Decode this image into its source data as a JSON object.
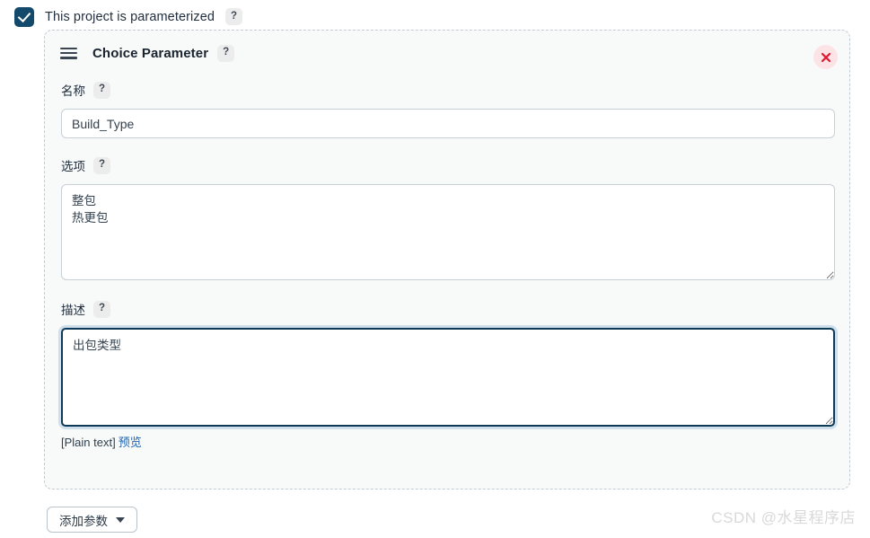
{
  "page": {
    "parameterized_toggle": {
      "label": "This project is parameterized",
      "checked": true,
      "help": "?"
    },
    "watermark": "CSDN @水星程序店"
  },
  "parameter_card": {
    "type_title": "Choice Parameter",
    "title_help": "?",
    "drag_handle_icon": "drag-handle-icon",
    "close_icon": "close-icon",
    "fields": {
      "name": {
        "label": "名称",
        "help": "?",
        "value": "Build_Type",
        "placeholder": ""
      },
      "choices": {
        "label": "选项",
        "help": "?",
        "value": "整包\n热更包",
        "placeholder": ""
      },
      "description": {
        "label": "描述",
        "help": "?",
        "value": "出包类型",
        "placeholder": "",
        "focused": true,
        "markup_note": "[Plain text]",
        "preview_link": "预览"
      }
    }
  },
  "toolbar": {
    "add_parameter_label": "添加参数",
    "caret_icon": "chevron-down-icon"
  },
  "colors": {
    "checkbox_fill": "#13496b",
    "card_border": "#c3ccd4",
    "card_background": "#f8f9f9",
    "focus_border": "#0e3a57",
    "close_bg": "#fbe3e6",
    "close_glyph": "#e0142d",
    "link": "#1f64ad"
  }
}
